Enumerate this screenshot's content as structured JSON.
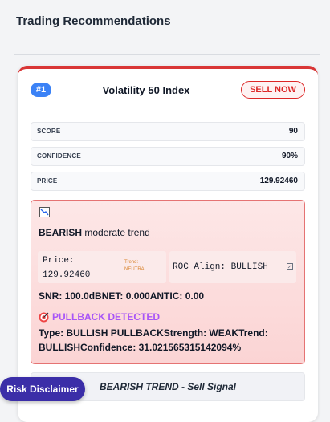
{
  "page": {
    "title": "Trading Recommendations"
  },
  "recommendation": {
    "rank": "#1",
    "symbol": "Volatility 50 Index",
    "action": "SELL NOW",
    "metrics": [
      {
        "label": "SCORE",
        "value": "90"
      },
      {
        "label": "CONFIDENCE",
        "value": "90%"
      },
      {
        "label": "PRICE",
        "value": "129.92460"
      }
    ],
    "trend": {
      "direction": "BEARISH",
      "strength_text": "moderate trend",
      "price_label": "Price:",
      "price_value": "129.92460",
      "trend_tag_label": "Trend:",
      "trend_tag_value": "NEUTRAL",
      "roc_align": "ROC Align: BULLISH",
      "snr_line": "SNR: 100.0dBNET: 0.000ANTIC: 0.00",
      "pullback_title": "PULLBACK DETECTED",
      "pullback_details": "Type: BULLISH PULLBACKStrength: WEAKTrend: BULLISHConfidence: 31.021565315142094%"
    },
    "signal": "BEARISH TREND - Sell Signal"
  },
  "risk_button": {
    "label": "Risk Disclaimer"
  },
  "colors": {
    "bearish": "#d93636",
    "pullback": "#a855f7",
    "rank_badge": "#3b82f6",
    "risk_button": "#3b2ea8"
  },
  "icons": {
    "trend": "chart-trend-icon",
    "pullback": "target-icon",
    "roc": "checkbox-icon"
  }
}
